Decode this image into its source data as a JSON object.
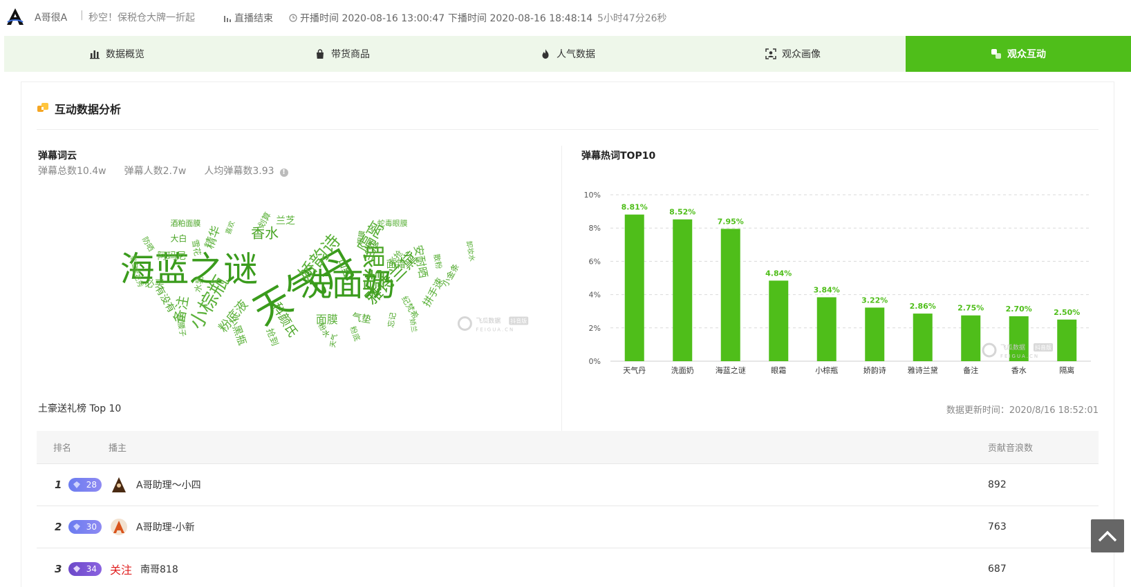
{
  "header": {
    "streamer_name": "A哥很A",
    "separator": "|",
    "title": "秒空！保税仓大牌一折起",
    "status": "直播结束",
    "start_label": "开播时间 2020-08-16 13:00:47",
    "end_label": "下播时间 2020-08-16 18:48:14",
    "duration": "5小时47分26秒"
  },
  "tabs": [
    {
      "label": "数据概览",
      "icon": "bar-chart-icon"
    },
    {
      "label": "带货商品",
      "icon": "shopping-bag-icon"
    },
    {
      "label": "人气数据",
      "icon": "flame-icon"
    },
    {
      "label": "观众画像",
      "icon": "portrait-icon"
    },
    {
      "label": "观众互动",
      "icon": "interaction-icon"
    }
  ],
  "section": {
    "title": "互动数据分析"
  },
  "wordcloud": {
    "title": "弹幕词云",
    "stat_total": "弹幕总数10.4w",
    "stat_people": "弹幕人数2.7w",
    "stat_avg": "人均弹幕数3.93",
    "words": [
      {
        "text": "海蓝之谜",
        "size": 50,
        "rotate": 0
      },
      {
        "text": "天气丹",
        "size": 54,
        "rotate": -30
      },
      {
        "text": "洗面奶",
        "size": 46,
        "rotate": 0
      },
      {
        "text": "眼霜",
        "size": 34,
        "rotate": 90
      },
      {
        "text": "小棕瓶",
        "size": 28,
        "rotate": -60
      },
      {
        "text": "娇韵诗",
        "size": 26,
        "rotate": -50
      },
      {
        "text": "雅诗兰黛",
        "size": 24,
        "rotate": -45
      },
      {
        "text": "隔离",
        "size": 24,
        "rotate": -60
      },
      {
        "text": "备注",
        "size": 20,
        "rotate": -80
      },
      {
        "text": "香水",
        "size": 20,
        "rotate": 0
      },
      {
        "text": "精华",
        "size": 17,
        "rotate": -70
      },
      {
        "text": "粉底液",
        "size": 18,
        "rotate": -50
      },
      {
        "text": "科颜氏",
        "size": 18,
        "rotate": 60
      },
      {
        "text": "安耐晒",
        "size": 16,
        "rotate": 80
      },
      {
        "text": "面膜",
        "size": 16,
        "rotate": 0
      },
      {
        "text": "兰蔻",
        "size": 16,
        "rotate": -70
      },
      {
        "text": "拼手速",
        "size": 15,
        "rotate": -60
      },
      {
        "text": "小黑瓶",
        "size": 15,
        "rotate": 70
      },
      {
        "text": "口红",
        "size": 14,
        "rotate": 70
      },
      {
        "text": "面霜",
        "size": 14,
        "rotate": 0
      },
      {
        "text": "必买",
        "size": 14,
        "rotate": 0
      },
      {
        "text": "有没有",
        "size": 14,
        "rotate": 60
      },
      {
        "text": "阿玛尼",
        "size": 14,
        "rotate": 0
      },
      {
        "text": "兰芝",
        "size": 14,
        "rotate": 0
      },
      {
        "text": "气垫",
        "size": 14,
        "rotate": 10
      },
      {
        "text": "抢到",
        "size": 13,
        "rotate": 70
      },
      {
        "text": "划算",
        "size": 12,
        "rotate": -60
      },
      {
        "text": "大白",
        "size": 12,
        "rotate": 0
      },
      {
        "text": "雪花",
        "size": 12,
        "rotate": 80
      },
      {
        "text": "必抢",
        "size": 12,
        "rotate": -50
      },
      {
        "text": "小金条",
        "size": 12,
        "rotate": -60
      },
      {
        "text": "水乳",
        "size": 12,
        "rotate": -80
      },
      {
        "text": "纪梵希",
        "size": 12,
        "rotate": 60
      },
      {
        "text": "忘记",
        "size": 11,
        "rotate": -80
      },
      {
        "text": "防晒",
        "size": 11,
        "rotate": 60
      },
      {
        "text": "散粉",
        "size": 11,
        "rotate": 80
      },
      {
        "text": "粉水",
        "size": 11,
        "rotate": 60
      },
      {
        "text": "粉底",
        "size": 11,
        "rotate": 70
      },
      {
        "text": "蛇毒眼膜",
        "size": 11,
        "rotate": 0
      },
      {
        "text": "酒粕面膜",
        "size": 11,
        "rotate": 0
      },
      {
        "text": "喜欢",
        "size": 10,
        "rotate": -70
      },
      {
        "text": "卸妆水",
        "size": 10,
        "rotate": 80
      },
      {
        "text": "天气",
        "size": 10,
        "rotate": -80
      },
      {
        "text": "雪花秀",
        "size": 10,
        "rotate": 70
      },
      {
        "text": "娇兰",
        "size": 10,
        "rotate": 80
      },
      {
        "text": "眼膜",
        "size": 10,
        "rotate": -80
      },
      {
        "text": "宝宝",
        "size": 10,
        "rotate": 80
      },
      {
        "text": "红腰子",
        "size": 11,
        "rotate": 80
      }
    ]
  },
  "watermark": {
    "brand": "飞瓜数据",
    "tag": "抖音版",
    "sub": "FEIGUA.CN"
  },
  "chart_data": {
    "type": "bar",
    "title": "弹幕热词TOP10",
    "categories": [
      "天气丹",
      "洗面奶",
      "海蓝之谜",
      "眼霜",
      "小棕瓶",
      "娇韵诗",
      "雅诗兰黛",
      "备注",
      "香水",
      "隔离"
    ],
    "values": [
      8.81,
      8.52,
      7.95,
      4.84,
      3.84,
      3.22,
      2.86,
      2.75,
      2.7,
      2.5
    ],
    "value_labels": [
      "8.81%",
      "8.52%",
      "7.95%",
      "4.84%",
      "3.84%",
      "3.22%",
      "2.86%",
      "2.75%",
      "2.70%",
      "2.50%"
    ],
    "yticks": [
      "0%",
      "2%",
      "4%",
      "6%",
      "8%",
      "10%"
    ],
    "ylim": [
      0,
      10
    ],
    "color": "#4fbe1a",
    "grid": true
  },
  "ranking": {
    "title": "土豪送礼榜 Top 10",
    "update_time": "数据更新时间：2020/8/16 18:52:01",
    "columns": {
      "rank": "排名",
      "user": "播主",
      "score": "贡献音浪数"
    },
    "rows": [
      {
        "rank": "1",
        "level": "28",
        "name": "A哥助理～小四",
        "score": "892"
      },
      {
        "rank": "2",
        "level": "30",
        "name": "A哥助理-小新",
        "score": "763"
      },
      {
        "rank": "3",
        "level": "34",
        "follow": "关注",
        "name": "南哥818",
        "score": "687"
      }
    ]
  },
  "colors": {
    "accent": "#4fbe1a",
    "tab_bg": "#eef7ea",
    "wordcloud": "#3a9b1c"
  }
}
